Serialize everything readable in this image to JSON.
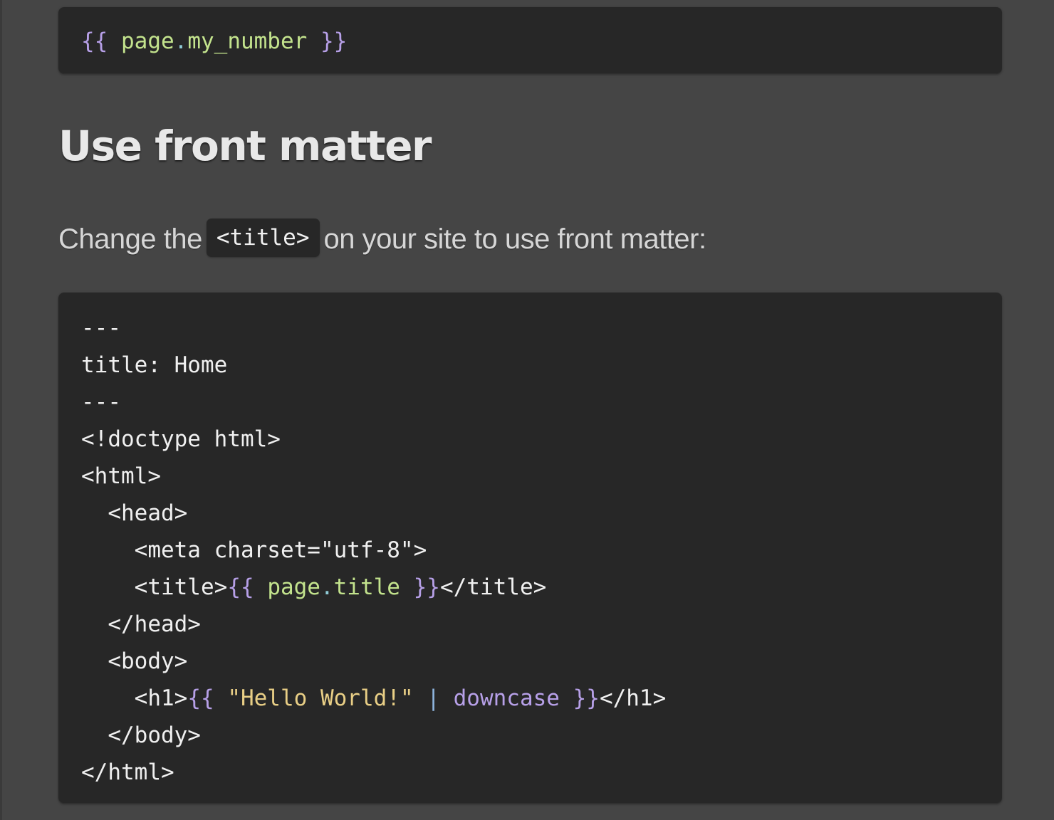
{
  "top_code": {
    "open": "{{",
    "var": "page",
    "dot": ".",
    "prop": "my_number",
    "close": "}}"
  },
  "heading": "Use front matter",
  "paragraph": {
    "before": "Change the",
    "code": "<title>",
    "after": "on your site to use front matter:"
  },
  "code_lines": {
    "l1": "---",
    "l2": "title: Home",
    "l3": "---",
    "l4": "<!doctype html>",
    "l5": "<html>",
    "l6": "  <head>",
    "l7": "    <meta charset=\"utf-8\">",
    "l8_open_tag": "    <title>",
    "l8_open": "{{",
    "l8_var": "page",
    "l8_dot": ".",
    "l8_prop": "title",
    "l8_close": "}}",
    "l8_close_tag": "</title>",
    "l9": "  </head>",
    "l10": "  <body>",
    "l11_open_tag": "    <h1>",
    "l11_open": "{{",
    "l11_str": "\"Hello World!\"",
    "l11_pipe": "|",
    "l11_filter": "downcase",
    "l11_close": "}}",
    "l11_close_tag": "</h1>",
    "l12": "  </body>",
    "l13": "</html>"
  },
  "colors": {
    "background": "#454545",
    "code_background": "#272727",
    "liquid_delimiter": "#b7a0e8",
    "liquid_variable": "#c3e38d",
    "liquid_string": "#e9cf86",
    "liquid_pipe": "#8fb6e0"
  }
}
